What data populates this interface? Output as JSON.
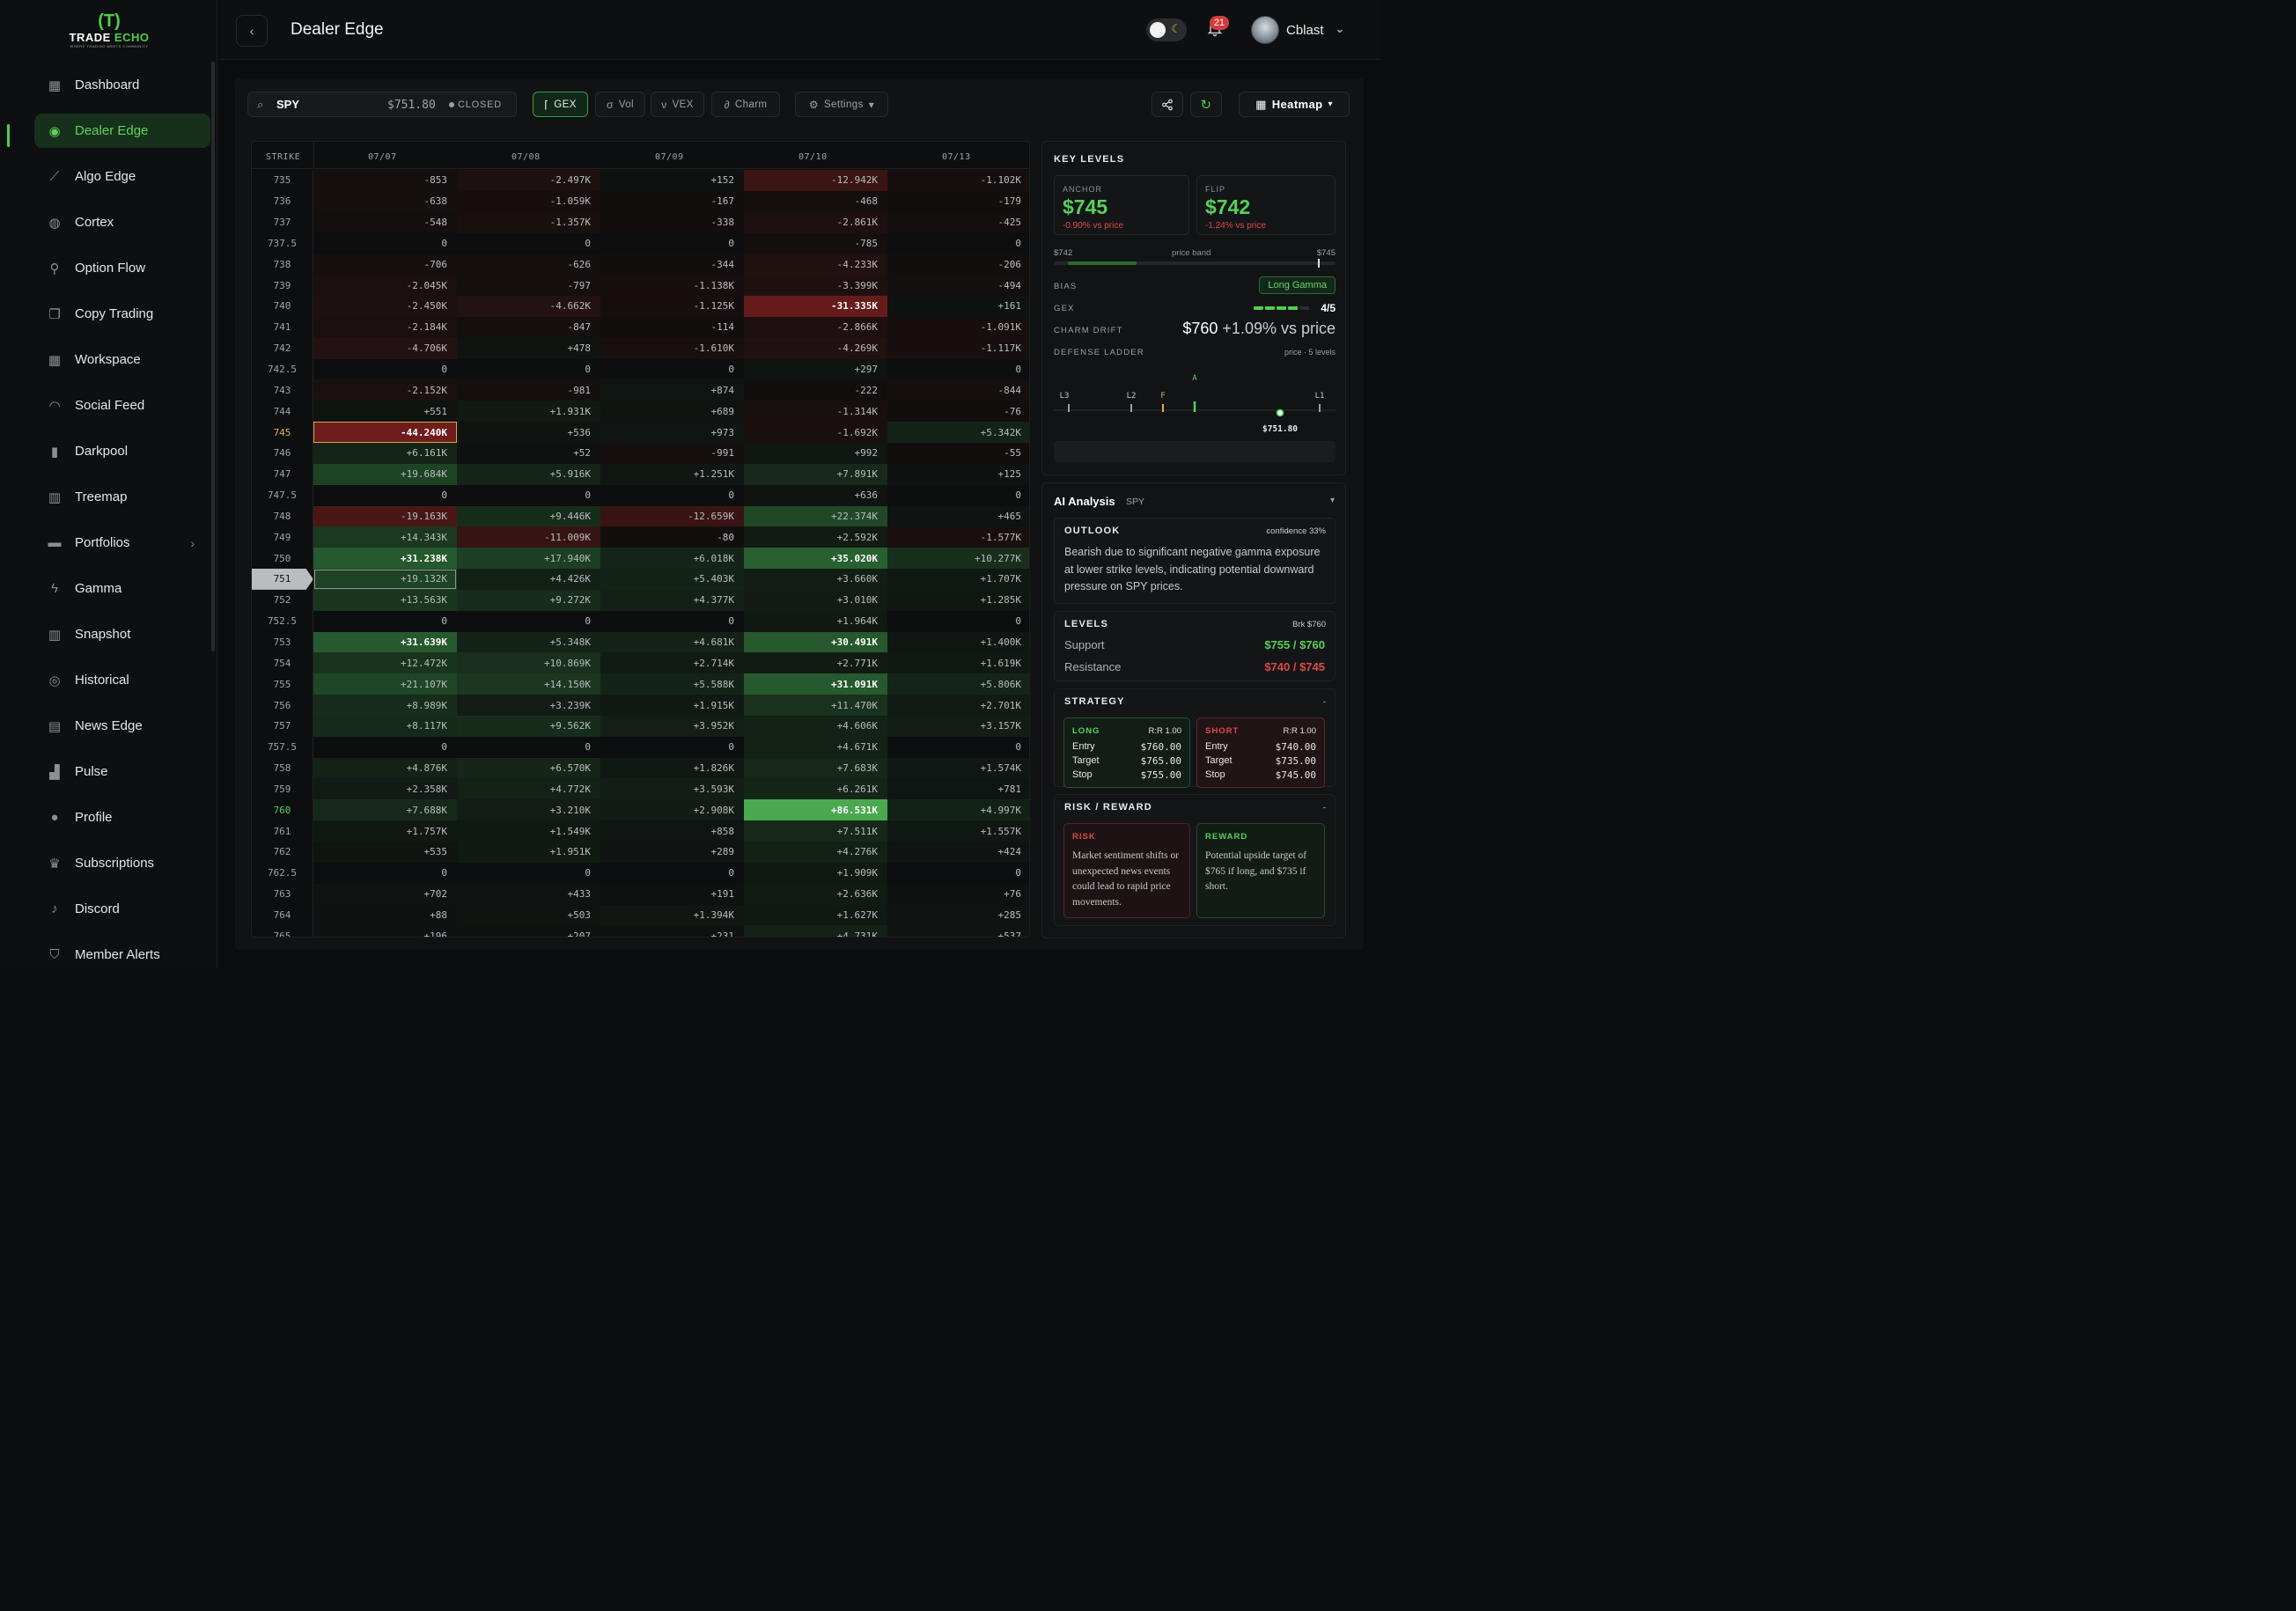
{
  "brand": {
    "mark": "(T)",
    "name_a": "TRADE ",
    "name_b": "ECHO",
    "tagline": "WHERE TRADING MEETS COMMUNITY"
  },
  "sidebar": {
    "items": [
      {
        "label": "Dashboard",
        "icon": "grid-icon",
        "glyph": "▦"
      },
      {
        "label": "Dealer Edge",
        "icon": "target-icon",
        "glyph": "◉",
        "active": true
      },
      {
        "label": "Algo Edge",
        "icon": "trend-icon",
        "glyph": "⟋"
      },
      {
        "label": "Cortex",
        "icon": "globe-icon",
        "glyph": "◍"
      },
      {
        "label": "Option Flow",
        "icon": "network-icon",
        "glyph": "⚲"
      },
      {
        "label": "Copy Trading",
        "icon": "copy-icon",
        "glyph": "❐"
      },
      {
        "label": "Workspace",
        "icon": "grid-icon",
        "glyph": "▦"
      },
      {
        "label": "Social Feed",
        "icon": "rss-icon",
        "glyph": "◠"
      },
      {
        "label": "Darkpool",
        "icon": "bars-icon",
        "glyph": "▮"
      },
      {
        "label": "Treemap",
        "icon": "bar-chart-icon",
        "glyph": "▥"
      },
      {
        "label": "Portfolios",
        "icon": "briefcase-icon",
        "glyph": "▬",
        "arrow": "›"
      },
      {
        "label": "Gamma",
        "icon": "bolt-icon",
        "glyph": "ϟ"
      },
      {
        "label": "Snapshot",
        "icon": "bar-chart-icon",
        "glyph": "▥"
      },
      {
        "label": "Historical",
        "icon": "history-icon",
        "glyph": "◎"
      },
      {
        "label": "News Edge",
        "icon": "newspaper-icon",
        "glyph": "▤"
      },
      {
        "label": "Pulse",
        "icon": "signal-icon",
        "glyph": "▟"
      },
      {
        "label": "Profile",
        "icon": "user-icon",
        "glyph": "●"
      },
      {
        "label": "Subscriptions",
        "icon": "crown-icon",
        "glyph": "♛"
      },
      {
        "label": "Discord",
        "icon": "mic-icon",
        "glyph": "♪"
      },
      {
        "label": "Member Alerts",
        "icon": "shield-icon",
        "glyph": "⛉"
      }
    ]
  },
  "header": {
    "back": "‹",
    "title": "Dealer Edge",
    "notif_count": "21",
    "user": "Cblast",
    "caret": "⌄"
  },
  "toolbar": {
    "symbol": "SPY",
    "price": "$751.80",
    "status": "CLOSED",
    "gex": "GEX",
    "vol": "Vol",
    "vex": "VEX",
    "charm": "Charm",
    "settings": "Settings",
    "view": "Heatmap"
  },
  "grid": {
    "strike_header": "STRIKE",
    "dates": [
      "07/07",
      "07/08",
      "07/09",
      "07/10",
      "07/13"
    ],
    "selected_strike": "745",
    "current_strike": "751",
    "highlight_strike": "760",
    "rows": [
      [
        "735",
        "-853",
        "-2.497K",
        "+152",
        "-12.942K",
        "-1.102K"
      ],
      [
        "736",
        "-638",
        "-1.059K",
        "-167",
        "-468",
        "-179"
      ],
      [
        "737",
        "-548",
        "-1.357K",
        "-338",
        "-2.861K",
        "-425"
      ],
      [
        "737.5",
        "0",
        "0",
        "0",
        "-785",
        "0"
      ],
      [
        "738",
        "-706",
        "-626",
        "-344",
        "-4.233K",
        "-206"
      ],
      [
        "739",
        "-2.045K",
        "-797",
        "-1.138K",
        "-3.399K",
        "-494"
      ],
      [
        "740",
        "-2.450K",
        "-4.662K",
        "-1.125K",
        "-31.335K",
        "+161"
      ],
      [
        "741",
        "-2.184K",
        "-847",
        "-114",
        "-2.866K",
        "-1.091K"
      ],
      [
        "742",
        "-4.706K",
        "+478",
        "-1.610K",
        "-4.269K",
        "-1.117K"
      ],
      [
        "742.5",
        "0",
        "0",
        "0",
        "+297",
        "0"
      ],
      [
        "743",
        "-2.152K",
        "-981",
        "+874",
        "-222",
        "-844"
      ],
      [
        "744",
        "+551",
        "+1.931K",
        "+689",
        "-1.314K",
        "-76"
      ],
      [
        "745",
        "-44.240K",
        "+536",
        "+973",
        "-1.692K",
        "+5.342K"
      ],
      [
        "746",
        "+6.161K",
        "+52",
        "-991",
        "+992",
        "-55"
      ],
      [
        "747",
        "+19.684K",
        "+5.916K",
        "+1.251K",
        "+7.891K",
        "+125"
      ],
      [
        "747.5",
        "0",
        "0",
        "0",
        "+636",
        "0"
      ],
      [
        "748",
        "-19.163K",
        "+9.446K",
        "-12.659K",
        "+22.374K",
        "+465"
      ],
      [
        "749",
        "+14.343K",
        "-11.009K",
        "-80",
        "+2.592K",
        "-1.577K"
      ],
      [
        "750",
        "+31.238K",
        "+17.940K",
        "+6.018K",
        "+35.020K",
        "+10.277K"
      ],
      [
        "751",
        "+19.132K",
        "+4.426K",
        "+5.403K",
        "+3.660K",
        "+1.707K"
      ],
      [
        "752",
        "+13.563K",
        "+9.272K",
        "+4.377K",
        "+3.010K",
        "+1.285K"
      ],
      [
        "752.5",
        "0",
        "0",
        "0",
        "+1.964K",
        "0"
      ],
      [
        "753",
        "+31.639K",
        "+5.348K",
        "+4.681K",
        "+30.491K",
        "+1.400K"
      ],
      [
        "754",
        "+12.472K",
        "+10.869K",
        "+2.714K",
        "+2.771K",
        "+1.619K"
      ],
      [
        "755",
        "+21.107K",
        "+14.150K",
        "+5.588K",
        "+31.091K",
        "+5.806K"
      ],
      [
        "756",
        "+8.989K",
        "+3.239K",
        "+1.915K",
        "+11.470K",
        "+2.701K"
      ],
      [
        "757",
        "+8.117K",
        "+9.562K",
        "+3.952K",
        "+4.606K",
        "+3.157K"
      ],
      [
        "757.5",
        "0",
        "0",
        "0",
        "+4.671K",
        "0"
      ],
      [
        "758",
        "+4.876K",
        "+6.570K",
        "+1.826K",
        "+7.683K",
        "+1.574K"
      ],
      [
        "759",
        "+2.358K",
        "+4.772K",
        "+3.593K",
        "+6.261K",
        "+781"
      ],
      [
        "760",
        "+7.688K",
        "+3.210K",
        "+2.908K",
        "+86.531K",
        "+4.997K"
      ],
      [
        "761",
        "+1.757K",
        "+1.549K",
        "+858",
        "+7.511K",
        "+1.557K"
      ],
      [
        "762",
        "+535",
        "+1.951K",
        "+289",
        "+4.276K",
        "+424"
      ],
      [
        "762.5",
        "0",
        "0",
        "0",
        "+1.909K",
        "0"
      ],
      [
        "763",
        "+702",
        "+433",
        "+191",
        "+2.636K",
        "+76"
      ],
      [
        "764",
        "+88",
        "+503",
        "+1.394K",
        "+1.627K",
        "+285"
      ],
      [
        "765",
        "+196",
        "+207",
        "+231",
        "+4.731K",
        "+537"
      ]
    ]
  },
  "key_levels": {
    "title": "KEY LEVELS",
    "anchor_label": "ANCHOR",
    "anchor": "$745",
    "anchor_sub": "-0.90% vs price",
    "flip_label": "FLIP",
    "flip": "$742",
    "flip_sub": "-1.24% vs price",
    "band_low": "$742",
    "band_label": "price band",
    "band_high": "$745",
    "bias_label": "BIAS",
    "bias": "Long Gamma",
    "gex_label": "GEX",
    "gex_score": "4/5",
    "gex_value": 4,
    "charm_label": "CHARM DRIFT",
    "charm_value": "$760",
    "charm_pct": "+1.09% vs price",
    "ladder_label": "DEFENSE LADDER",
    "ladder_sub": "price · 5 levels",
    "ladder_marks": [
      "L3",
      "L2",
      "F",
      "A",
      "L1"
    ],
    "ladder_price": "$751.80"
  },
  "ai": {
    "title": "AI Analysis",
    "symbol": "SPY",
    "outlook_title": "OUTLOOK",
    "confidence": "confidence 33%",
    "outlook_text": "Bearish due to significant negative gamma exposure at lower strike levels, indicating potential downward pressure on SPY prices.",
    "levels_title": "LEVELS",
    "levels_note": "Brk $760",
    "support_label": "Support",
    "support": "$755 / $760",
    "resistance_label": "Resistance",
    "resistance": "$740 / $745",
    "strategy_title": "STRATEGY",
    "long": {
      "label": "LONG",
      "rr": "R:R 1.00",
      "entry": "$760.00",
      "target": "$765.00",
      "stop": "$755.00"
    },
    "short": {
      "label": "SHORT",
      "rr": "R:R 1.00",
      "entry": "$740.00",
      "target": "$735.00",
      "stop": "$745.00"
    },
    "entry_label": "Entry",
    "target_label": "Target",
    "stop_label": "Stop",
    "rr_title": "RISK / REWARD",
    "risk_label": "RISK",
    "risk_text": "Market sentiment shifts or unexpected news events could lead to rapid price movements.",
    "reward_label": "REWARD",
    "reward_text": "Potential upside target of $765 if long, and $735 if short."
  },
  "colors": {
    "accent": "#4ecf4e",
    "negative": "#e04848",
    "positive": "#57d15a"
  }
}
